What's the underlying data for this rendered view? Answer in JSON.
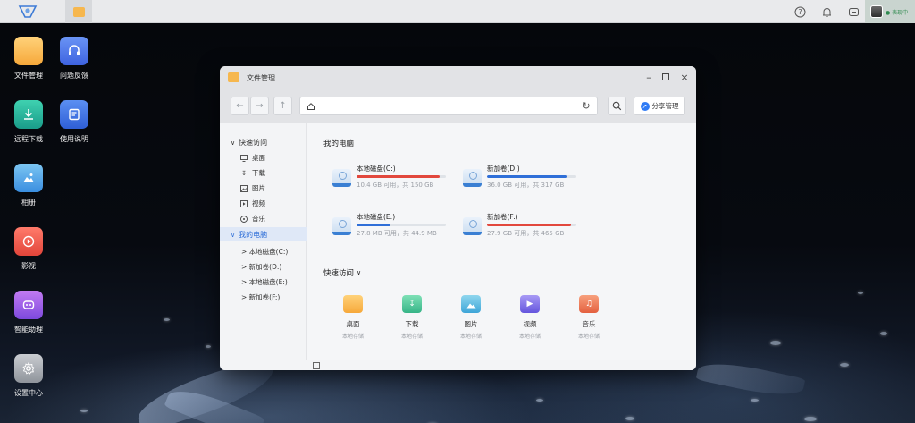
{
  "taskbar": {
    "logo_icon": "nas-logo-icon",
    "active_app_icon": "folder-icon",
    "right_icons": [
      "help-icon",
      "bell-icon",
      "message-icon"
    ],
    "user": {
      "avatar_icon": "user-avatar",
      "status_text": "● 表现中"
    }
  },
  "desktop": {
    "icons": [
      {
        "label": "文件管理",
        "icon": "folder-icon",
        "color": "#f6b74e"
      },
      {
        "label": "问题反馈",
        "icon": "headset-icon",
        "color": "#4f7cf0"
      },
      {
        "label": "远程下载",
        "icon": "download-icon",
        "color": "#27b69c"
      },
      {
        "label": "使用说明",
        "icon": "manual-icon",
        "color": "#3e74e8"
      },
      {
        "label": "相册",
        "icon": "photo-icon",
        "color": "#4aa6e8"
      },
      {
        "label": "影视",
        "icon": "play-icon",
        "color": "#ee5a4c"
      },
      {
        "label": "智能助理",
        "icon": "assistant-icon",
        "color": "#9f5fe6"
      },
      {
        "label": "设置中心",
        "icon": "gear-icon",
        "color": "#a9adb4"
      }
    ]
  },
  "window": {
    "title": "文件管理",
    "controls": [
      "minimize-icon",
      "maximize-icon",
      "close-icon"
    ],
    "toolbar": {
      "back_icon": "arrow-left-icon",
      "forward_icon": "arrow-right-icon",
      "up_icon": "arrow-up-icon",
      "address_icon": "home-icon",
      "refresh_icon": "refresh-icon",
      "search_icon": "search-icon",
      "share_label": "分享管理"
    },
    "sidebar": {
      "quick_access_label": "快速访问",
      "quick_items": [
        {
          "label": "桌面",
          "icon": "desktop-icon"
        },
        {
          "label": "下载",
          "icon": "download-icon"
        },
        {
          "label": "图片",
          "icon": "image-icon"
        },
        {
          "label": "视频",
          "icon": "video-icon"
        },
        {
          "label": "音乐",
          "icon": "music-icon"
        }
      ],
      "my_computer_label": "我的电脑",
      "drives": [
        "> 本地磁盘(C:)",
        "> 新加卷(D:)",
        "> 本地磁盘(E:)",
        "> 新加卷(F:)"
      ]
    },
    "main": {
      "my_computer_title": "我的电脑",
      "drives": [
        {
          "name": "本地磁盘(C:)",
          "info": "10.4 GB 可用，共 150 GB",
          "used_fraction": 0.93,
          "bar_color": "#e2483d"
        },
        {
          "name": "新加卷(D:)",
          "info": "36.0 GB 可用，共 317 GB",
          "used_fraction": 0.89,
          "bar_color": "#2f6fd8"
        },
        {
          "name": "本地磁盘(E:)",
          "info": "27.8 MB 可用，共 44.9 MB",
          "used_fraction": 0.38,
          "bar_color": "#2f6fd8"
        },
        {
          "name": "新加卷(F:)",
          "info": "27.9 GB 可用，共 465 GB",
          "used_fraction": 0.94,
          "bar_color": "#e2483d"
        }
      ],
      "quick_access_title": "快速访问",
      "quick_items": [
        {
          "name": "桌面",
          "sub": "本地存储",
          "icon": "folder-icon",
          "color": "#f6b74e"
        },
        {
          "name": "下载",
          "sub": "本地存储",
          "icon": "download-icon",
          "color": "#46c49a"
        },
        {
          "name": "图片",
          "sub": "本地存储",
          "icon": "image-icon",
          "color": "#55b3e0"
        },
        {
          "name": "视频",
          "sub": "本地存储",
          "icon": "video-icon",
          "color": "#7a6ee8"
        },
        {
          "name": "音乐",
          "sub": "本地存储",
          "icon": "music-icon",
          "color": "#ee7a55"
        }
      ]
    }
  }
}
